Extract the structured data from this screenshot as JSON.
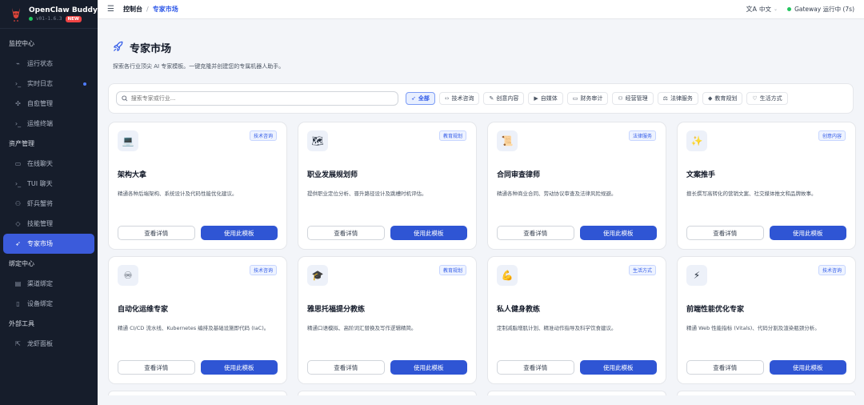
{
  "app": {
    "name": "OpenClaw Buddy",
    "version": "v01-1.6.3",
    "badge": "NEW"
  },
  "sidebar": {
    "sections": [
      {
        "title": "监控中心",
        "items": [
          {
            "label": "运行状态",
            "icon": "activity-icon"
          },
          {
            "label": "实时日志",
            "icon": "terminal-icon",
            "unread": true
          },
          {
            "label": "自愈管理",
            "icon": "heal-icon"
          },
          {
            "label": "运维终端",
            "icon": "terminal-icon"
          }
        ]
      },
      {
        "title": "资产管理",
        "items": [
          {
            "label": "在线聊天",
            "icon": "chat-icon"
          },
          {
            "label": "TUI 聊天",
            "icon": "terminal-icon"
          },
          {
            "label": "虾兵蟹将",
            "icon": "people-icon"
          },
          {
            "label": "技能管理",
            "icon": "skill-icon"
          },
          {
            "label": "专家市场",
            "icon": "rocket-icon",
            "active": true
          }
        ]
      },
      {
        "title": "绑定中心",
        "items": [
          {
            "label": "渠道绑定",
            "icon": "channel-icon"
          },
          {
            "label": "设备绑定",
            "icon": "device-icon"
          }
        ]
      },
      {
        "title": "外部工具",
        "items": [
          {
            "label": "龙虾面板",
            "icon": "external-link-icon"
          }
        ]
      }
    ]
  },
  "topbar": {
    "breadcrumb": [
      "控制台",
      "专家市场"
    ],
    "language": "中文",
    "gateway_status": "Gateway 运行中 (7s)"
  },
  "page": {
    "title": "专家市场",
    "description": "探索各行业顶尖 AI 专家模板。一键克隆并创建您的专属机器人助手。"
  },
  "filters": {
    "search_placeholder": "搜索专家或行业...",
    "categories": [
      {
        "label": "全部",
        "icon": "rocket-icon",
        "active": true
      },
      {
        "label": "技术咨询",
        "icon": "code-icon"
      },
      {
        "label": "创意内容",
        "icon": "brush-icon"
      },
      {
        "label": "自媒体",
        "icon": "video-icon"
      },
      {
        "label": "财务审计",
        "icon": "money-icon"
      },
      {
        "label": "经营管理",
        "icon": "team-icon"
      },
      {
        "label": "法律服务",
        "icon": "scale-icon"
      },
      {
        "label": "教育规划",
        "icon": "graduation-icon"
      },
      {
        "label": "生活方式",
        "icon": "heart-icon"
      }
    ]
  },
  "actions": {
    "detail": "查看详情",
    "use": "使用此模板"
  },
  "experts": [
    {
      "icon": "💻",
      "tag": "技术咨询",
      "title": "架构大拿",
      "desc": "精通各种后端架构、系统设计及代码性能优化建议。"
    },
    {
      "icon": "🗺",
      "tag": "教育规划",
      "title": "职业发展规划师",
      "desc": "提供职业定位分析、晋升路径设计及跳槽时机评估。"
    },
    {
      "icon": "📜",
      "tag": "法律服务",
      "title": "合同审查律师",
      "desc": "精通各种商业合同、劳动协议审查及法律风险规避。"
    },
    {
      "icon": "✨",
      "tag": "创意内容",
      "title": "文案推手",
      "desc": "擅长撰写高转化的营销文案、社交媒体推文和品牌故事。"
    },
    {
      "icon": "♾",
      "tag": "技术咨询",
      "title": "自动化运维专家",
      "desc": "精通 CI/CD 流水线、Kubernetes 编排及基础设施即代码 (IaC)。"
    },
    {
      "icon": "🎓",
      "tag": "教育规划",
      "title": "雅思托福提分教练",
      "desc": "精通口语模拟、高阶词汇替换及写作逻辑精简。"
    },
    {
      "icon": "💪",
      "tag": "生活方式",
      "title": "私人健身教练",
      "desc": "定制减脂增肌计划、精准动作指导及科学饮食建议。"
    },
    {
      "icon": "⚡",
      "tag": "技术咨询",
      "title": "前端性能优化专家",
      "desc": "精通 Web 性能指标 (Vitals)、代码分割及渲染瓶颈分析。"
    }
  ]
}
